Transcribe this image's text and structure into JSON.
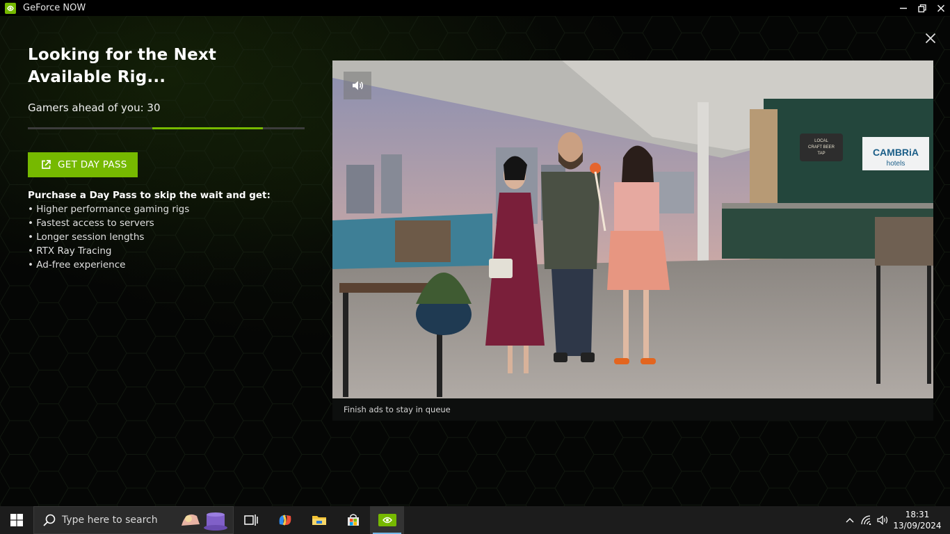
{
  "window": {
    "title": "GeForce NOW"
  },
  "queue_screen": {
    "heading": "Looking for the Next Available Rig...",
    "queue_text": "Gamers ahead of you: 30",
    "progress_segment_start": 0.45,
    "progress_segment_end": 0.85,
    "day_pass_button": "GET DAY PASS",
    "benefits_title": "Purchase a Day Pass to skip the wait and get:",
    "benefits": [
      "Higher performance gaming rigs",
      "Fastest access to servers",
      "Longer session lengths",
      "RTX Ray Tracing",
      "Ad-free experience"
    ]
  },
  "video": {
    "caption": "Finish ads to stay in queue",
    "sign_brand": "CAMBRiA",
    "sign_sub": "hotels",
    "chalk_sign": [
      "LOCAL",
      "CRAFT BEER",
      "TAP"
    ],
    "mute_icon": "speaker-icon"
  },
  "taskbar": {
    "search_placeholder": "Type here to search",
    "time": "18:31",
    "date": "13/09/2024"
  },
  "colors": {
    "accent": "#76b900",
    "background": "#050605"
  }
}
